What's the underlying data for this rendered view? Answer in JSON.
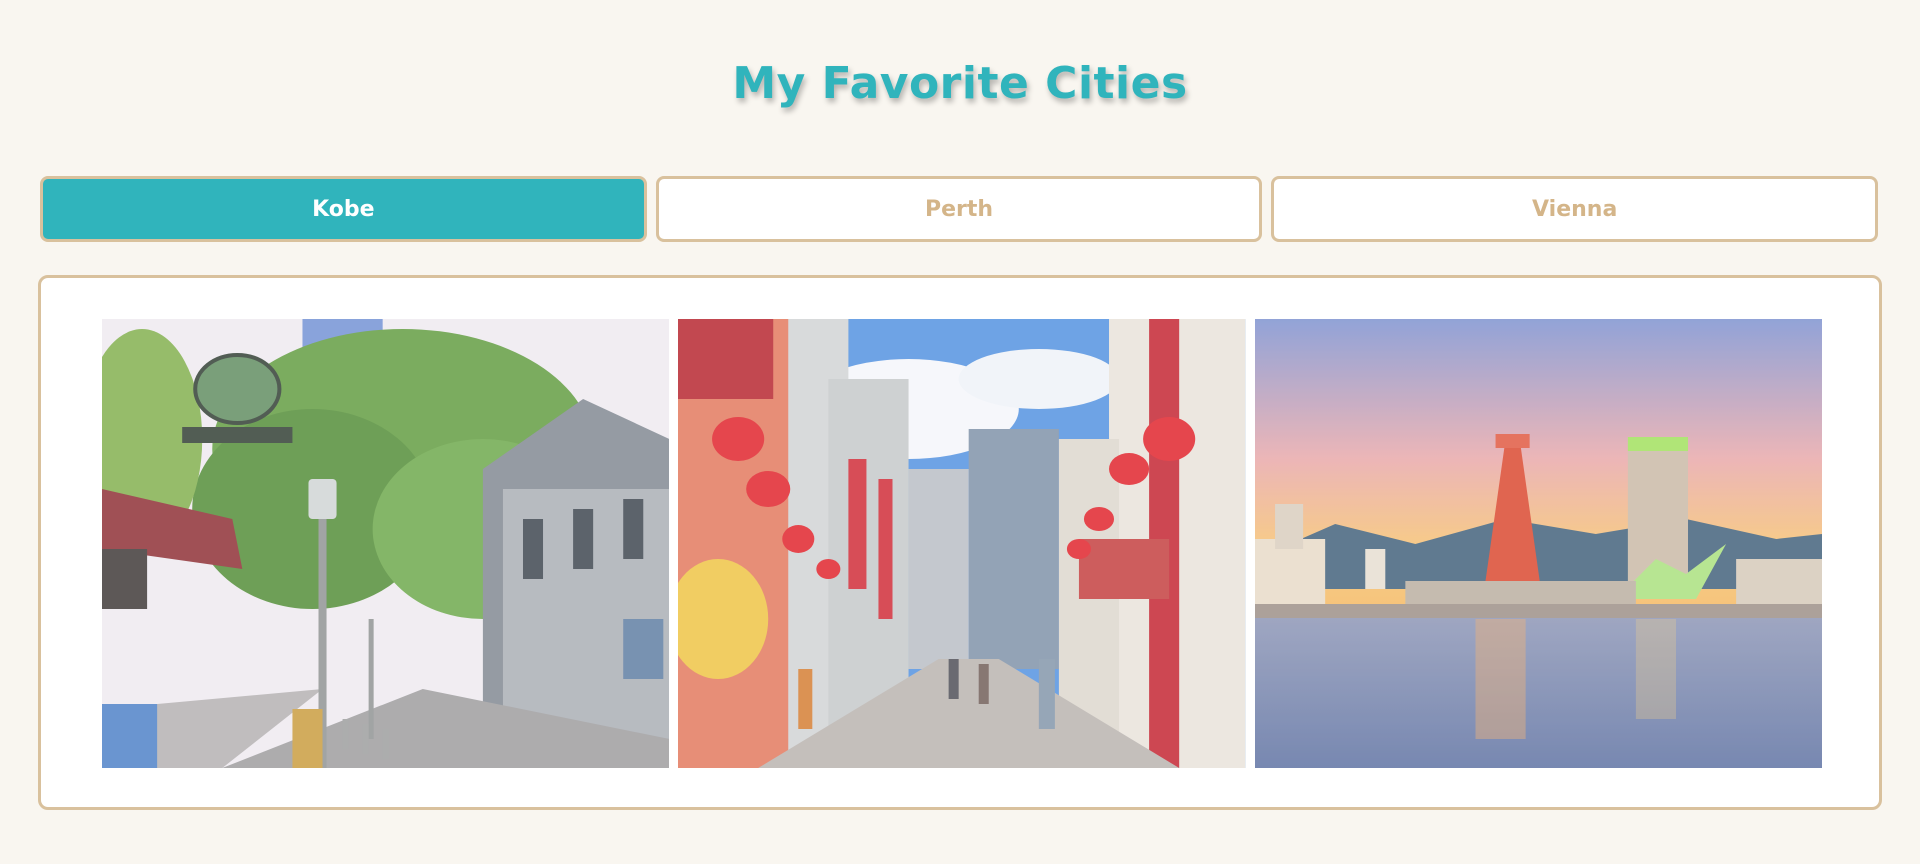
{
  "header": {
    "title": "My Favorite Cities"
  },
  "tabs": [
    {
      "label": "Kobe",
      "active": true
    },
    {
      "label": "Perth",
      "active": false
    },
    {
      "label": "Vienna",
      "active": false
    }
  ],
  "colors": {
    "accent": "#30b4bc",
    "border": "#d9c19d",
    "inactive_text": "#d4b589",
    "background": "#f9f6f0"
  },
  "gallery": {
    "images": [
      {
        "name": "kobe-kitano-street-photo"
      },
      {
        "name": "kobe-chinatown-nankinmachi-photo"
      },
      {
        "name": "kobe-port-tower-harbor-sunset-photo"
      }
    ]
  }
}
